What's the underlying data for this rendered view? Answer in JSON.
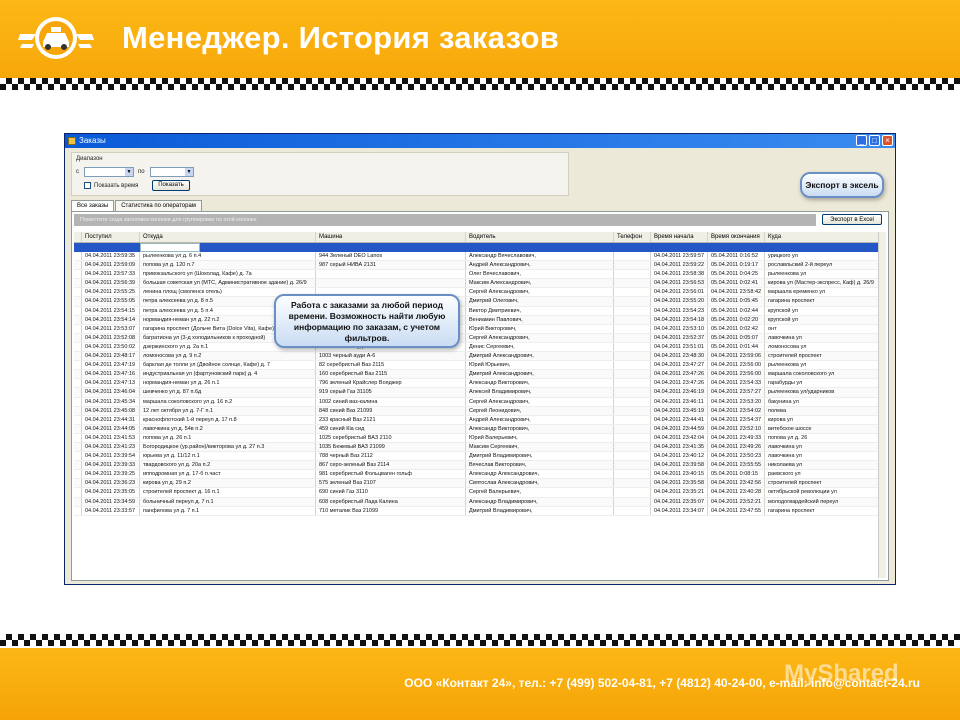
{
  "slide": {
    "title": "Менеджер. История заказов",
    "footer": "ООО «Контакт 24», тел.: +7 (499) 502-04-81, +7 (4812) 40-24-00, e-mail: info@contact-24.ru",
    "watermark": "MyShared"
  },
  "window": {
    "title": "Заказы",
    "range_label": "Диапазон",
    "from_label": "с",
    "to_label": "по",
    "show_time_label": "Показать время",
    "show_button": "Показать",
    "tabs": [
      "Все заказы",
      "Статистика по операторам"
    ],
    "group_hint": "Поместите сюда заголовок колонки для группировки по этой колонке",
    "excel_button": "Экспорт в Excel",
    "columns": [
      "Поступил",
      "Откуда",
      "Машина",
      "Водитель",
      "Телефон",
      "Время начала",
      "Время окончания",
      "Куда"
    ],
    "rows": [
      [
        "04.04.2011 23:59:35",
        "рылеенкова ул д. 6 п.4",
        "944 Зеленый DEO Lanos",
        "Александр Вячеславович,",
        "",
        "04.04.2011 23:59:57",
        "05.04.2011 0:16:52",
        "урицкого ул"
      ],
      [
        "04.04.2011 23:59:09",
        "попова ул д. 120 п.7",
        "987 серый НИВА 2131",
        "Андрей Александрович,",
        "",
        "04.04.2011 23:59:22",
        "05.04.2011 0:19:17",
        "рославльский 2-й переул"
      ],
      [
        "04.04.2011 23:57:33",
        "привокзальского ул (Шоколад, Кафе) д. 7а",
        "",
        "Олег Вячеславович,",
        "",
        "04.04.2011 23:58:38",
        "05.04.2011 0:04:25",
        "рылеенкова ул"
      ],
      [
        "04.04.2011 23:56:39",
        "большая советская ул (МТС, Административное здание) д. 26/9",
        "",
        "Максим Александрович,",
        "",
        "04.04.2011 23:56:53",
        "05.04.2011 0:02:41",
        "кирова ул (Мастер-экспресс, Каф) д. 26/9"
      ],
      [
        "04.04.2011 23:55:25",
        "ленина площ (смоленск отель)",
        "",
        "Сергей Александрович,",
        "",
        "04.04.2011 23:56:01",
        "04.04.2011 23:58:42",
        "маршала еременко ул"
      ],
      [
        "04.04.2011 23:55:05",
        "петра алексеева ул д. 8 п.5",
        "",
        "Дмитрий Олегович,",
        "",
        "04.04.2011 23:55:20",
        "05.04.2011 0:05:45",
        "гагарина проспект"
      ],
      [
        "04.04.2011 23:54:15",
        "петра алексеева ул д. 5 п.4",
        "",
        "Виктор Дмитриевич,",
        "",
        "04.04.2011 23:54:23",
        "05.04.2011 0:02:44",
        "крупской ул"
      ],
      [
        "04.04.2011 23:54:14",
        "нормандия-неман ул д. 22 п.2",
        "",
        "Вениамин Павлович,",
        "",
        "04.04.2011 23:54:18",
        "05.04.2011 0:02:20",
        "крупской ул"
      ],
      [
        "04.04.2011 23:53:07",
        "гагарина проспект (Дольче Вита (Dolce Vita), Кафе) д. 7",
        "",
        "Юрий Викторович,",
        "",
        "04.04.2011 23:53:10",
        "05.04.2011 0:02:42",
        "онт"
      ],
      [
        "04.04.2011 23:52:08",
        "багратиона ул (3-д холодильников к проходной)",
        "1041 черный Ауди а6",
        "Сергей Александрович,",
        "",
        "04.04.2011 23:52:37",
        "05.04.2011 0:05:07",
        "лавочкина ул"
      ],
      [
        "04.04.2011 23:50:02",
        "дзержинского ул д. 2а п.1",
        "30 вишневая Ауди",
        "Денис Сергеевич,",
        "",
        "04.04.2011 23:51:01",
        "05.04.2011 0:01:44",
        "ломоносова ул"
      ],
      [
        "04.04.2011 23:48:17",
        "ломоносова ул д. 9 п.2",
        "1003 черный ауди А-6",
        "Дмитрий Александрович,",
        "",
        "04.04.2011 23:48:30",
        "04.04.2011 23:59:06",
        "строителей проспект"
      ],
      [
        "04.04.2011 23:47:19",
        "барклая де толли ул (Двойное солнце, Кафе) д. 7",
        "82 серебристый Ваз 2115",
        "Юрий Юрьевич,",
        "",
        "04.04.2011 23:47:27",
        "04.04.2011 23:56:00",
        "рылеенкова ул"
      ],
      [
        "04.04.2011 23:47:16",
        "индустриальная ул (фартуновский парк) д. 4",
        "160 серебристый Ваз 2115",
        "Дмитрий Александрович,",
        "",
        "04.04.2011 23:47:26",
        "04.04.2011 23:56:00",
        "маршала соколовского ул"
      ],
      [
        "04.04.2011 23:47:13",
        "нормандия-неман ул д. 26 п.1",
        "796 зеленый Крайслер Вояджер",
        "Александр Викторович,",
        "",
        "04.04.2011 23:47:26",
        "04.04.2011 23:54:33",
        "гарабурды ул"
      ],
      [
        "04.04.2011 23:46:04",
        "шевченко ул д. 87 п.6д",
        "919 серый Газ 31105",
        "Алексей Владимирович,",
        "",
        "04.04.2011 23:46:19",
        "04.04.2011 23:57:27",
        "рылеенкова ул/ударников"
      ],
      [
        "04.04.2011 23:45:34",
        "маршала соколовского ул д. 16 п.2",
        "1002 синий ваз-калина",
        "Сергей Александрович,",
        "",
        "04.04.2011 23:46:11",
        "04.04.2011 23:53:20",
        "бакунина ул"
      ],
      [
        "04.04.2011 23:45:08",
        "12 лет октября ул д. 7-Г п.1",
        "848 синий Ваз 21099",
        "Сергей Леонидович,",
        "",
        "04.04.2011 23:45:19",
        "04.04.2011 23:54:02",
        "полева"
      ],
      [
        "04.04.2011 23:44:31",
        "краснофлотский 1-й переул д. 17 п.8",
        "233 красный Ваз 2121",
        "Андрей Александрович,",
        "",
        "04.04.2011 23:44:41",
        "04.04.2011 23:54:37",
        "кирова ул"
      ],
      [
        "04.04.2011 23:44:05",
        "лавочкина ул д. 54в п.2",
        "459 синий Кia сид",
        "Александр Викторович,",
        "",
        "04.04.2011 23:44:59",
        "04.04.2011 23:52:10",
        "витебское шоссе"
      ],
      [
        "04.04.2011 23:41:53",
        "попова ул д. 26 п.1",
        "1025 серебристый ВАЗ 2110",
        "Юрий Валерьевич,",
        "",
        "04.04.2011 23:42:04",
        "04.04.2011 23:49:33",
        "попова ул д. 26"
      ],
      [
        "04.04.2011 23:41:23",
        "Богородицкое (ур.район)/викторова ул д. 27 п.3",
        "1035 Бежевый ВАЗ 21099",
        "Максим Сергеевич,",
        "",
        "04.04.2011 23:41:35",
        "04.04.2011 23:49:26",
        "лавочкина ул"
      ],
      [
        "04.04.2011 23:39:54",
        "юрьева ул д. 11/12 п.1",
        "788 черный Ваз 2112",
        "Дмитрий Владимирович,",
        "",
        "04.04.2011 23:40:12",
        "04.04.2011 23:50:23",
        "лавочкина ул"
      ],
      [
        "04.04.2011 23:39:33",
        "твардовского ул д. 20а п.2",
        "867 серо-зеленый Ваз 2114",
        "Вячеслав Викторович,",
        "",
        "04.04.2011 23:39:58",
        "04.04.2011 23:55:55",
        "николаева ул"
      ],
      [
        "04.04.2011 23:39:25",
        "ипподромная ул д. 17-б п.част",
        "981 серебристый Фольцваген гольф",
        "Александр Александрович,",
        "",
        "04.04.2011 23:40:15",
        "05.04.2011 0:08:15",
        "раевского ул"
      ],
      [
        "04.04.2011 23:36:23",
        "кирова ул д. 29 п.2",
        "575 зеленый Ваз 2107",
        "Святослав Александрович,",
        "",
        "04.04.2011 23:35:58",
        "04.04.2011 23:42:56",
        "строителей проспект"
      ],
      [
        "04.04.2011 23:35:05",
        "строителей проспект д. 16 п.1",
        "690 синий Газ 3110",
        "Сергей Валерьевич,",
        "",
        "04.04.2011 23:35:21",
        "04.04.2011 23:40:28",
        "октябрьской революции ул"
      ],
      [
        "04.04.2011 23:34:59",
        "больничный переул д. 7 п.1",
        "608 серебристый Лада Калина",
        "Александр Владимирович,",
        "",
        "04.04.2011 23:35:07",
        "04.04.2011 23:52:21",
        "молодогвардейский переул"
      ],
      [
        "04.04.2011 23:33:57",
        "панфилова ул д. 7 п.1",
        "710 металик Ваз 21099",
        "Дмитрий Владимирович,",
        "",
        "04.04.2011 23:34:07",
        "04.04.2011 23:47:55",
        "гагарина проспект"
      ]
    ]
  },
  "callouts": {
    "time": "Работа с заказами за любой период времени. Возможность найти любую информацию по заказам, с учетом фильтров.",
    "excel": "Экспорт в эксель"
  },
  "colors": {
    "accent": "#fcb815",
    "selection": "#2457c5"
  }
}
